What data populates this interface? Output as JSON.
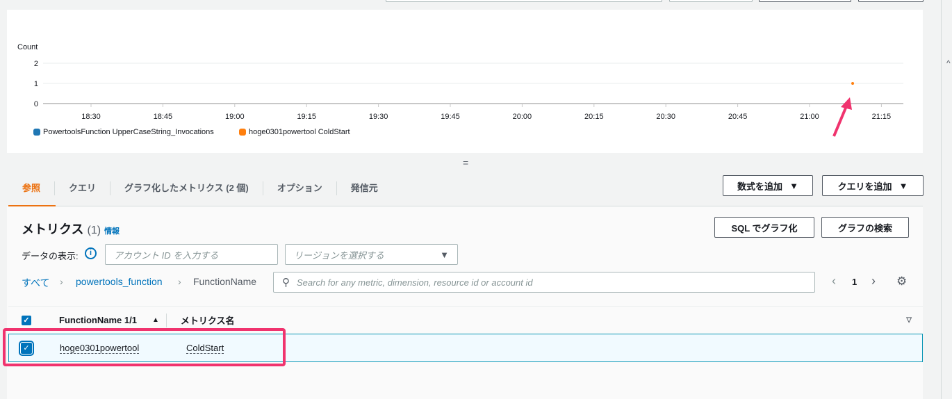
{
  "chart_data": {
    "type": "line",
    "ylabel": "Count",
    "y_ticks": [
      "0",
      "1",
      "2"
    ],
    "ylim": [
      0,
      2
    ],
    "x_ticks": [
      "18:30",
      "18:45",
      "19:00",
      "19:15",
      "19:30",
      "19:45",
      "20:00",
      "20:15",
      "20:30",
      "20:45",
      "21:00",
      "21:15"
    ],
    "series": [
      {
        "name": "PowertoolsFunction UpperCaseString_Invocations",
        "color": "#1f77b4",
        "points": []
      },
      {
        "name": "hoge0301powertool ColdStart",
        "color": "#ff7f0e",
        "points": [
          {
            "x": "21:09",
            "y": 1
          }
        ]
      }
    ]
  },
  "divider": "=",
  "tabs": [
    {
      "label": "参照",
      "active": true
    },
    {
      "label": "クエリ"
    },
    {
      "label": "グラフ化したメトリクス (2 個)"
    },
    {
      "label": "オプション"
    },
    {
      "label": "発信元"
    }
  ],
  "buttons": {
    "add_math": "数式を追加",
    "add_query": "クエリを追加",
    "sql_graph": "SQL でグラフ化",
    "graph_search": "グラフの検索"
  },
  "metrics": {
    "title": "メトリクス",
    "count": "(1)",
    "info": "情報",
    "data_display_label": "データの表示:",
    "account_placeholder": "アカウント ID を入力する",
    "region_placeholder": "リージョンを選択する",
    "breadcrumb": [
      "すべて",
      "powertools_function",
      "FunctionName"
    ],
    "search_placeholder": "Search for any metric, dimension, resource id or account id",
    "page": "1",
    "columns": [
      "FunctionName 1/1",
      "メトリクス名"
    ],
    "rows": [
      {
        "function_name": "hoge0301powertool",
        "metric": "ColdStart",
        "checked": true
      }
    ]
  }
}
